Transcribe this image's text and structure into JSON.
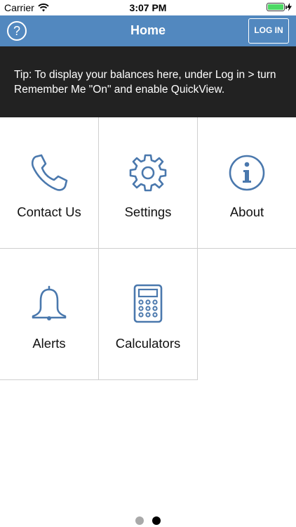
{
  "status_bar": {
    "carrier": "Carrier",
    "time": "3:07 PM"
  },
  "nav": {
    "help_label": "?",
    "title": "Home",
    "login_label": "LOG IN"
  },
  "tip": {
    "text": "Tip: To display your balances here, under Log in > turn Remember Me \"On\" and enable QuickView."
  },
  "tiles": [
    {
      "label": "Contact Us",
      "icon": "phone-icon"
    },
    {
      "label": "Settings",
      "icon": "gear-icon"
    },
    {
      "label": "About",
      "icon": "info-icon"
    },
    {
      "label": "Alerts",
      "icon": "bell-icon"
    },
    {
      "label": "Calculators",
      "icon": "calculator-icon"
    }
  ],
  "pager": {
    "page_count": 2,
    "current_page": 2
  },
  "colors": {
    "nav": "#5288bf",
    "icon": "#4a78ad",
    "tip_bg": "#222222",
    "dot_inactive": "#a9a9a9",
    "dot_active": "#000000"
  }
}
